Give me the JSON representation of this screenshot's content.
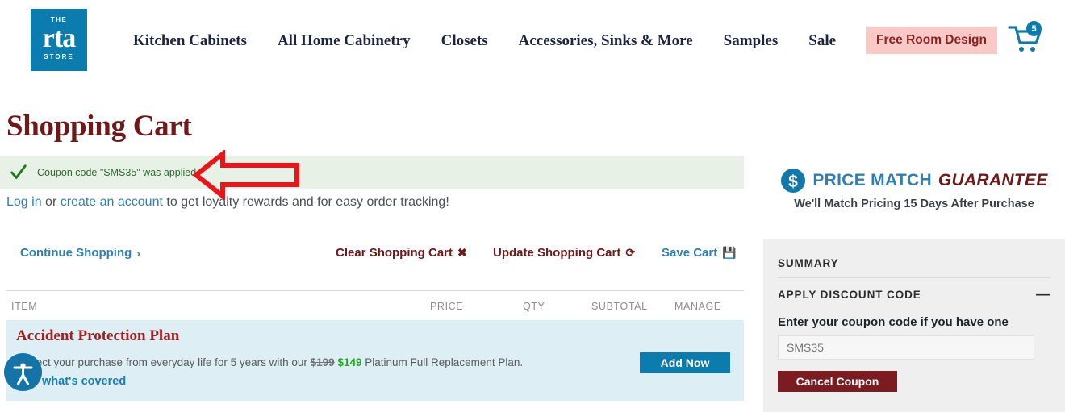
{
  "header": {
    "logo": {
      "top": "THE",
      "main": "rta",
      "bottom": "STORE"
    },
    "nav": [
      {
        "label": "Kitchen Cabinets"
      },
      {
        "label": "All Home Cabinetry"
      },
      {
        "label": "Closets"
      },
      {
        "label": "Accessories, Sinks & More"
      },
      {
        "label": "Samples"
      },
      {
        "label": "Sale"
      }
    ],
    "free_room_design": "Free Room Design",
    "cart_icon": "shopping-cart-icon",
    "cart_count": "5",
    "colors": {
      "logo_bg": "#0b7cad",
      "promo_bg": "#f9c9c6",
      "promo_text": "#8b2222"
    }
  },
  "main": {
    "page_title": "Shopping Cart",
    "alert": {
      "icon": "check-icon",
      "text": "Coupon code \"SMS35\" was applied.",
      "bg": "#e7f1e6",
      "text_color": "#2f6b33"
    },
    "annotation": {
      "shape": "left-arrow",
      "color": "#e8161a"
    },
    "login_line": {
      "login_link": "Log in",
      "or": " or ",
      "create_link": "create an account",
      "rest": " to get loyalty rewards and for easy order tracking!"
    },
    "actions": {
      "continue": "Continue Shopping",
      "continue_glyph": "›",
      "clear": "Clear Shopping Cart",
      "clear_glyph": "✖",
      "update": "Update Shopping Cart",
      "update_glyph": "⟳",
      "save": "Save Cart",
      "save_glyph": "💾"
    },
    "table_headers": {
      "item": "ITEM",
      "price": "PRICE",
      "qty": "QTY",
      "subtotal": "SUBTOTAL",
      "manage": "MANAGE"
    },
    "protection_plan": {
      "title": "Accident Protection Plan",
      "desc_prefix": "Protect your purchase from everyday life for 5 years with our ",
      "price_old": "$199",
      "price_new": "$149",
      "desc_suffix": " Platinum Full Replacement Plan.",
      "link": "what's covered",
      "button": "Add Now",
      "bg": "#ddeef5",
      "title_color": "#a32020"
    },
    "accessibility_widget": "accessibility-icon"
  },
  "sidebar": {
    "price_match": {
      "icon": "dollar-circle-icon",
      "part_a": "PRICE MATCH",
      "part_b": "GUARANTEE",
      "subtitle": "We'll Match Pricing 15 Days After Purchase"
    },
    "summary_title": "SUMMARY",
    "discount_title": "APPLY DISCOUNT CODE",
    "collapse_glyph": "—",
    "coupon_label": "Enter your coupon code if you have one",
    "coupon_value": "SMS35",
    "coupon_placeholder": "SMS35",
    "cancel_button": "Cancel Coupon",
    "panel_bg": "#efefef",
    "cancel_bg": "#7a1c22"
  }
}
